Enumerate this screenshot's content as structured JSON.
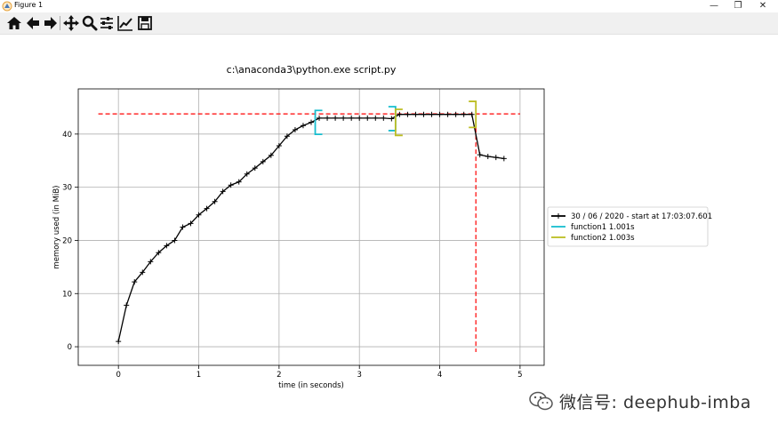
{
  "window": {
    "title": "Figure 1",
    "icon": "matplotlib-icon",
    "controls": [
      "minimize-icon",
      "maximize-icon",
      "close-icon"
    ]
  },
  "toolbar": {
    "buttons": [
      "home-icon",
      "back-icon",
      "forward-icon",
      "pan-icon",
      "zoom-icon",
      "configure-subplots-icon",
      "edit-axis-icon",
      "save-icon"
    ]
  },
  "watermark": {
    "text": "微信号: deephub-imba",
    "icon": "wechat-icon"
  },
  "chart_data": {
    "type": "line",
    "title": "c:\\anaconda3\\python.exe script.py",
    "xlabel": "time (in seconds)",
    "ylabel": "memory used (in MiB)",
    "xlim": [
      -0.5,
      5.3
    ],
    "ylim": [
      -3.5,
      48.5
    ],
    "xticks": [
      0,
      1,
      2,
      3,
      4,
      5
    ],
    "yticks": [
      0,
      10,
      20,
      30,
      40
    ],
    "grid": true,
    "legend_position": "right",
    "series": [
      {
        "name": "30 / 06 / 2020 - start at 17:03:07.601",
        "color": "#000000",
        "marker": "+",
        "x": [
          0.0,
          0.1,
          0.2,
          0.3,
          0.4,
          0.5,
          0.6,
          0.7,
          0.8,
          0.9,
          1.0,
          1.1,
          1.2,
          1.3,
          1.4,
          1.5,
          1.6,
          1.7,
          1.8,
          1.9,
          2.0,
          2.1,
          2.2,
          2.3,
          2.4,
          2.5,
          2.6,
          2.7,
          2.8,
          2.9,
          3.0,
          3.1,
          3.2,
          3.3,
          3.4,
          3.5,
          3.6,
          3.7,
          3.8,
          3.9,
          4.0,
          4.1,
          4.2,
          4.3,
          4.4,
          4.5,
          4.6,
          4.7,
          4.8
        ],
        "y": [
          1.0,
          7.8,
          12.2,
          14.0,
          16.0,
          17.7,
          19.0,
          20.0,
          22.5,
          23.2,
          24.8,
          26.0,
          27.3,
          29.2,
          30.4,
          31.0,
          32.5,
          33.6,
          34.8,
          36.0,
          37.8,
          39.6,
          40.8,
          41.6,
          42.2,
          43.0,
          43.0,
          43.0,
          43.0,
          43.0,
          43.0,
          43.0,
          43.0,
          43.0,
          42.9,
          43.7,
          43.7,
          43.7,
          43.7,
          43.7,
          43.7,
          43.7,
          43.7,
          43.7,
          43.7,
          36.1,
          35.8,
          35.6,
          35.4
        ]
      }
    ],
    "brackets": [
      {
        "name": "function1 1.001s",
        "color": "#17becf",
        "start": {
          "x": 2.45,
          "y": 42.2
        },
        "end": {
          "x": 3.45,
          "y": 42.9
        },
        "height": 4.5
      },
      {
        "name": "function2 1.003s",
        "color": "#bcbd22",
        "start": {
          "x": 3.45,
          "y": 42.2
        },
        "end": {
          "x": 4.45,
          "y": 43.7
        },
        "height": 4.9
      }
    ],
    "peak": {
      "color": "#ff0000",
      "y": 43.8,
      "x": 4.45,
      "hline_xrange": [
        -0.25,
        5.0
      ],
      "vline_ybottom": -1.0
    },
    "legend": [
      {
        "label": "30 / 06 / 2020 - start at 17:03:07.601",
        "color": "#000000",
        "marker": "+"
      },
      {
        "label": "function1 1.001s",
        "color": "#17becf"
      },
      {
        "label": "function2 1.003s",
        "color": "#bcbd22"
      }
    ]
  }
}
